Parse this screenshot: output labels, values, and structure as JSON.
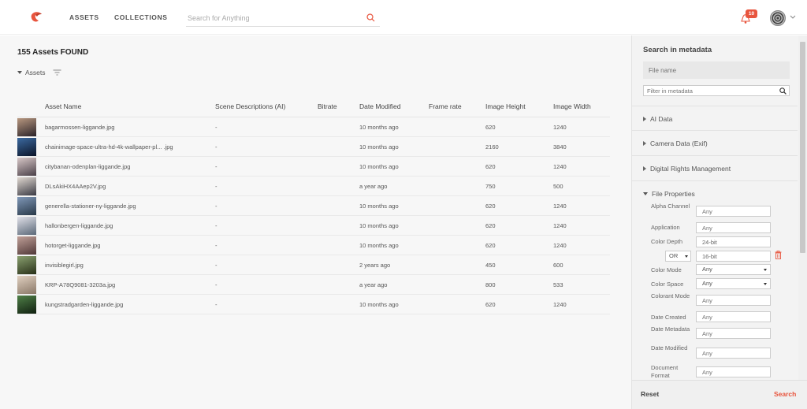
{
  "nav": {
    "assets": "ASSETS",
    "collections": "COLLECTIONS",
    "search_placeholder": "Search for Anything",
    "notification_count": "10"
  },
  "colors": {
    "accent": "#e8553e"
  },
  "main": {
    "found_title": "155 Assets FOUND",
    "assets_toggle": "Assets",
    "columns": [
      "Asset Name",
      "Scene Descriptions (AI)",
      "Bitrate",
      "Date Modified",
      "Frame rate",
      "Image Height",
      "Image Width"
    ],
    "rows": [
      {
        "name": "bagarmossen-liggande.jpg",
        "scene": "-",
        "bitrate": "",
        "date": "10 months ago",
        "frame": "",
        "height": "620",
        "width": "1240",
        "thumb": [
          "#b89880",
          "#2a2228"
        ]
      },
      {
        "name": "chainimage-space-ultra-hd-4k-wallpaper-pl... .jpg",
        "scene": "-",
        "bitrate": "",
        "date": "10 months ago",
        "frame": "",
        "height": "2160",
        "width": "3840",
        "thumb": [
          "#3c6aa0",
          "#0a1428"
        ]
      },
      {
        "name": "citybanan-odenplan-liggande.jpg",
        "scene": "-",
        "bitrate": "",
        "date": "10 months ago",
        "frame": "",
        "height": "620",
        "width": "1240",
        "thumb": [
          "#d8c8c8",
          "#4a4048"
        ]
      },
      {
        "name": "DLsAkiHX4AAep2V.jpg",
        "scene": "-",
        "bitrate": "",
        "date": "a year ago",
        "frame": "",
        "height": "750",
        "width": "500",
        "thumb": [
          "#e0d8d0",
          "#3a3a44"
        ]
      },
      {
        "name": "generella-stationer-ny-liggande.jpg",
        "scene": "-",
        "bitrate": "",
        "date": "10 months ago",
        "frame": "",
        "height": "620",
        "width": "1240",
        "thumb": [
          "#8098b8",
          "#283848"
        ]
      },
      {
        "name": "hallonbergen-liggande.jpg",
        "scene": "-",
        "bitrate": "",
        "date": "10 months ago",
        "frame": "",
        "height": "620",
        "width": "1240",
        "thumb": [
          "#e0e0e8",
          "#5a6878"
        ]
      },
      {
        "name": "hotorget-liggande.jpg",
        "scene": "-",
        "bitrate": "",
        "date": "10 months ago",
        "frame": "",
        "height": "620",
        "width": "1240",
        "thumb": [
          "#c0a098",
          "#503838"
        ]
      },
      {
        "name": "invisiblegirl.jpg",
        "scene": "-",
        "bitrate": "",
        "date": "2 years ago",
        "frame": "",
        "height": "450",
        "width": "600",
        "thumb": [
          "#8aa070",
          "#283018"
        ]
      },
      {
        "name": "KRP-A78Q9081-3203a.jpg",
        "scene": "-",
        "bitrate": "",
        "date": "a year ago",
        "frame": "",
        "height": "800",
        "width": "533",
        "thumb": [
          "#e0d0c0",
          "#8a7868"
        ]
      },
      {
        "name": "kungstradgarden-liggande.jpg",
        "scene": "-",
        "bitrate": "",
        "date": "10 months ago",
        "frame": "",
        "height": "620",
        "width": "1240",
        "thumb": [
          "#508048",
          "#102010"
        ]
      }
    ]
  },
  "panel": {
    "title": "Search in metadata",
    "file_name_placeholder": "File name",
    "filter_placeholder": "Filter in metadata",
    "sections": [
      "AI Data",
      "Camera Data (Exif)",
      "Digital Rights Management",
      "File Properties"
    ],
    "props": {
      "alpha_channel": {
        "label": "Alpha Channel",
        "value": "Any"
      },
      "application": {
        "label": "Application",
        "value": "Any"
      },
      "color_depth": {
        "label": "Color Depth",
        "value": "24-bit"
      },
      "color_depth_or": {
        "op": "OR",
        "value": "16-bit"
      },
      "color_mode": {
        "label": "Color Mode",
        "value": "Any"
      },
      "color_space": {
        "label": "Color Space",
        "value": "Any"
      },
      "colorant_mode": {
        "label": "Colorant Mode",
        "value": "Any"
      },
      "date_created": {
        "label": "Date Created",
        "value": "Any"
      },
      "date_metadata": {
        "label": "Date Metadata",
        "value": "Any"
      },
      "date_modified": {
        "label": "Date Modified",
        "value": "Any"
      },
      "document_format": {
        "label": "Document Format",
        "value": "Any"
      }
    },
    "reset": "Reset",
    "search": "Search"
  }
}
